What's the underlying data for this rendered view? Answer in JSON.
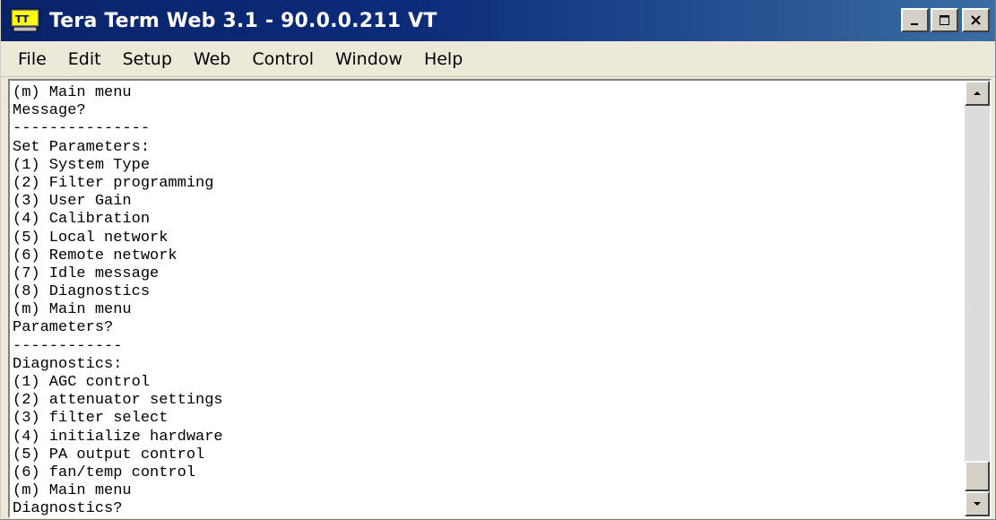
{
  "window": {
    "title": "Tera Term Web 3.1 - 90.0.0.211 VT",
    "icon": "tera-term-app-icon"
  },
  "caption_buttons": {
    "minimize": "minimize-icon",
    "maximize": "maximize-icon",
    "close": "close-icon"
  },
  "menu": {
    "items": [
      {
        "label": "File"
      },
      {
        "label": "Edit"
      },
      {
        "label": "Setup"
      },
      {
        "label": "Web"
      },
      {
        "label": "Control"
      },
      {
        "label": "Window"
      },
      {
        "label": "Help"
      }
    ]
  },
  "terminal": {
    "lines": [
      "(m) Main menu",
      "Message?",
      "---------------",
      "Set Parameters:",
      "(1) System Type",
      "(2) Filter programming",
      "(3) User Gain",
      "(4) Calibration",
      "(5) Local network",
      "(6) Remote network",
      "(7) Idle message",
      "(8) Diagnostics",
      "(m) Main menu",
      "Parameters?",
      "------------",
      "Diagnostics:",
      "(1) AGC control",
      "(2) attenuator settings",
      "(3) filter select",
      "(4) initialize hardware",
      "(5) PA output control",
      "(6) fan/temp control",
      "(m) Main menu",
      "Diagnostics?"
    ]
  },
  "scrollbar": {
    "up_icon": "scroll-up-arrow-icon",
    "down_icon": "scroll-down-arrow-icon",
    "position": 1.0
  },
  "colors": {
    "titlebar_start": "#0a246a",
    "titlebar_end": "#3a6ea5",
    "terminal_bg": "#ffffff",
    "terminal_fg": "#000000"
  }
}
